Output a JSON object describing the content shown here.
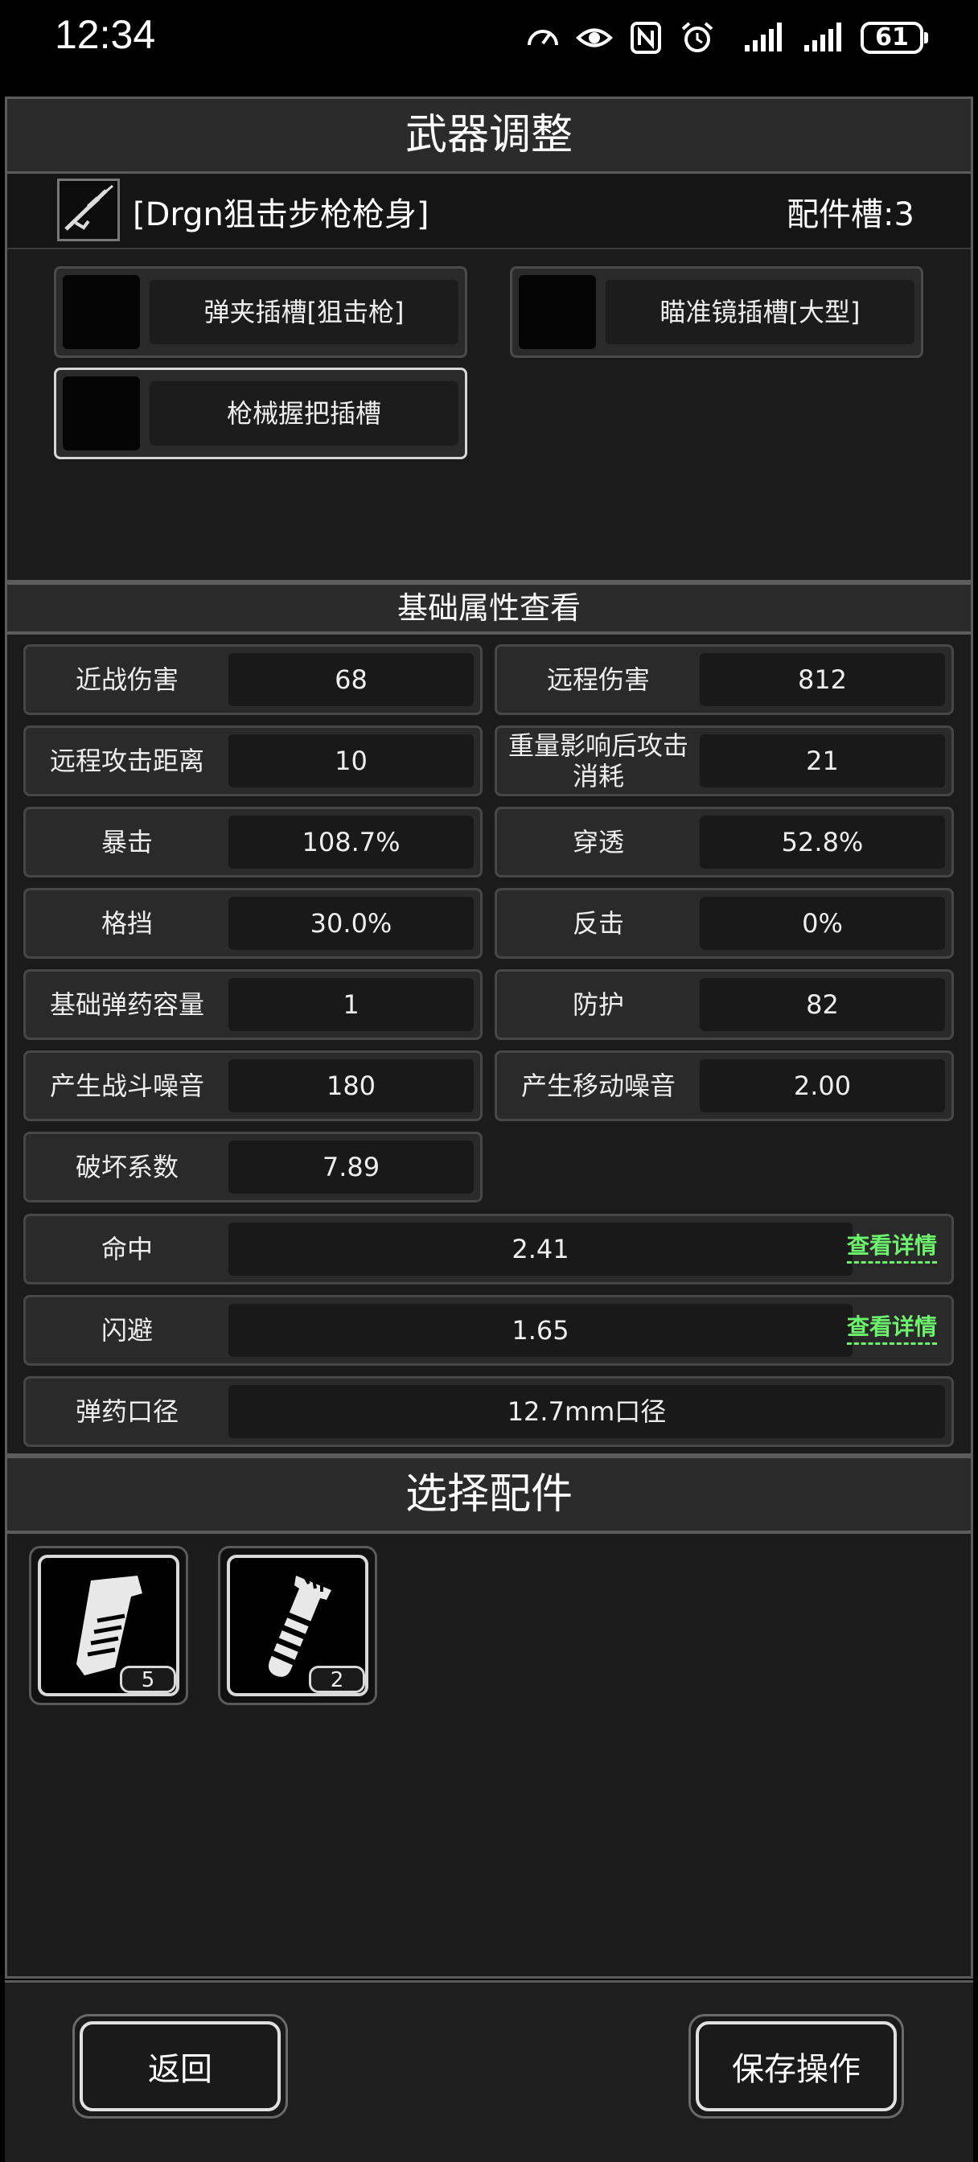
{
  "status_bar": {
    "time": "12:34",
    "battery": "61"
  },
  "title": "武器调整",
  "weapon": {
    "name": "[Drgn狙击步枪枪身]",
    "slot_count": "配件槽:3"
  },
  "slots": [
    {
      "label": "弹夹插槽[狙击枪]"
    },
    {
      "label": "瞄准镜插槽[大型]"
    },
    {
      "label": "枪械握把插槽"
    }
  ],
  "attributes_title": "基础属性查看",
  "stats": [
    {
      "name": "近战伤害",
      "value": "68"
    },
    {
      "name": "远程伤害",
      "value": "812"
    },
    {
      "name": "远程攻击距离",
      "value": "10"
    },
    {
      "name": "重量影响后攻击消耗",
      "value": "21"
    },
    {
      "name": "暴击",
      "value": "108.7%"
    },
    {
      "name": "穿透",
      "value": "52.8%"
    },
    {
      "name": "格挡",
      "value": "30.0%"
    },
    {
      "name": "反击",
      "value": "0%"
    },
    {
      "name": "基础弹药容量",
      "value": "1"
    },
    {
      "name": "防护",
      "value": "82"
    },
    {
      "name": "产生战斗噪音",
      "value": "180"
    },
    {
      "name": "产生移动噪音",
      "value": "2.00"
    },
    {
      "name": "破坏系数",
      "value": "7.89"
    }
  ],
  "wide_stats": [
    {
      "name": "命中",
      "value": "2.41",
      "link": "查看详情"
    },
    {
      "name": "闪避",
      "value": "1.65",
      "link": "查看详情"
    },
    {
      "name": "弹药口径",
      "value": "12.7mm口径"
    }
  ],
  "parts_title": "选择配件",
  "parts": [
    {
      "icon": "grip-icon",
      "count": "5"
    },
    {
      "icon": "suppressor-icon",
      "count": "2"
    }
  ],
  "buttons": {
    "back": "返回",
    "save": "保存操作"
  },
  "colors": {
    "link_green": "#6df26d",
    "panel": "#1b1b1b",
    "header": "#2b2b2b"
  }
}
